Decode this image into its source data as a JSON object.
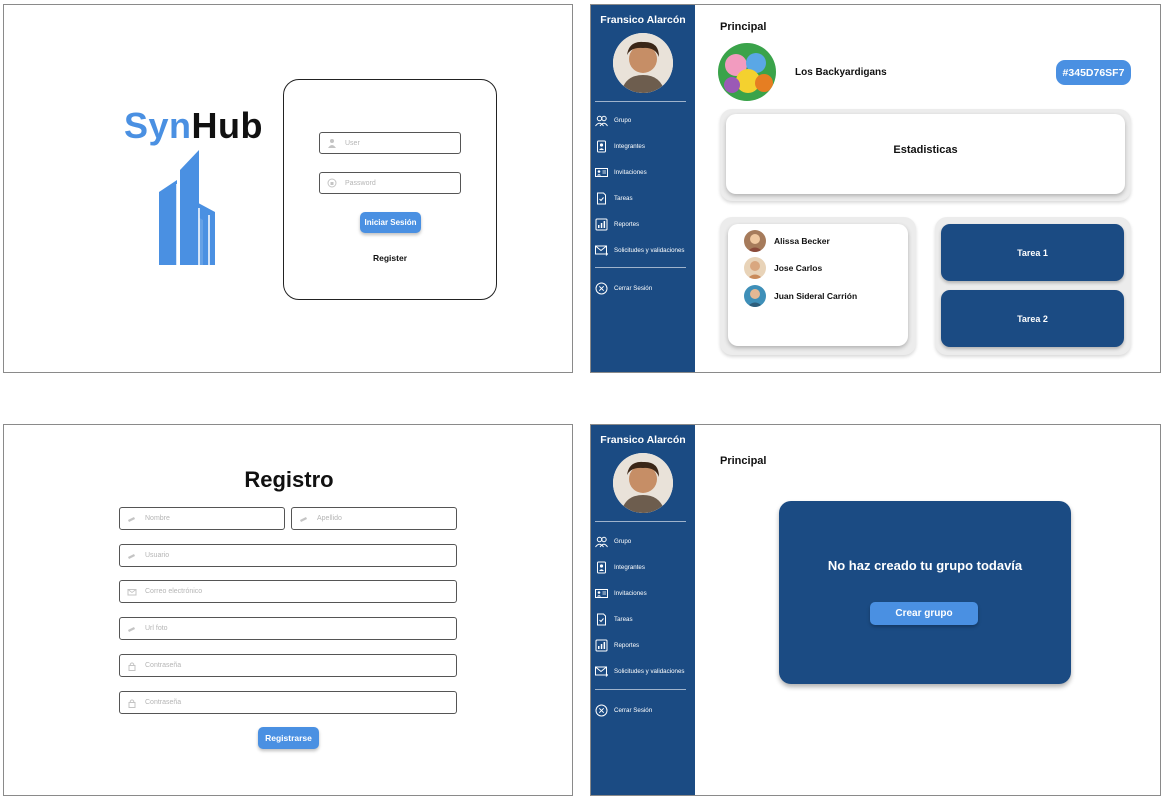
{
  "login": {
    "logo_syn": "Syn",
    "logo_hub": "Hub",
    "user_placeholder": "User",
    "password_placeholder": "Password",
    "login_button": "Iniciar Sesión",
    "register_link": "Register"
  },
  "sidebar": {
    "user_name": "Fransico Alarcón",
    "items": [
      {
        "label": "Grupo",
        "icon": "group-icon"
      },
      {
        "label": "Integrantes",
        "icon": "members-icon"
      },
      {
        "label": "Invitaciones",
        "icon": "invitations-icon"
      },
      {
        "label": "Tareas",
        "icon": "tasks-icon"
      },
      {
        "label": "Reportes",
        "icon": "reports-icon"
      },
      {
        "label": "Solicitudes y validaciones",
        "icon": "requests-icon"
      }
    ],
    "logout": "Cerrar Sesión"
  },
  "dashboard": {
    "heading": "Principal",
    "group_name": "Los Backyardigans",
    "group_code": "#345D76SF7",
    "stats_title": "Estadisticas",
    "members": [
      "Alissa Becker",
      "Jose Carlos",
      "Juan Sideral Carrión"
    ],
    "tasks": [
      "Tarea 1",
      "Tarea 2"
    ]
  },
  "register": {
    "title": "Registro",
    "fields": {
      "nombre": "Nombre",
      "apellido": "Apellido",
      "usuario": "Usuario",
      "correo": "Correo electrónico",
      "url_foto": "Url foto",
      "contrasena": "Contraseña",
      "contrasena_confirm": "Contraseña"
    },
    "submit": "Registrarse"
  },
  "empty_group": {
    "heading": "Principal",
    "message": "No haz creado tu grupo todavía",
    "create_button": "Crear grupo"
  },
  "colors": {
    "brand_blue": "#4a90e2",
    "sidebar_navy": "#1b4b83",
    "card_grey": "#ececec"
  }
}
